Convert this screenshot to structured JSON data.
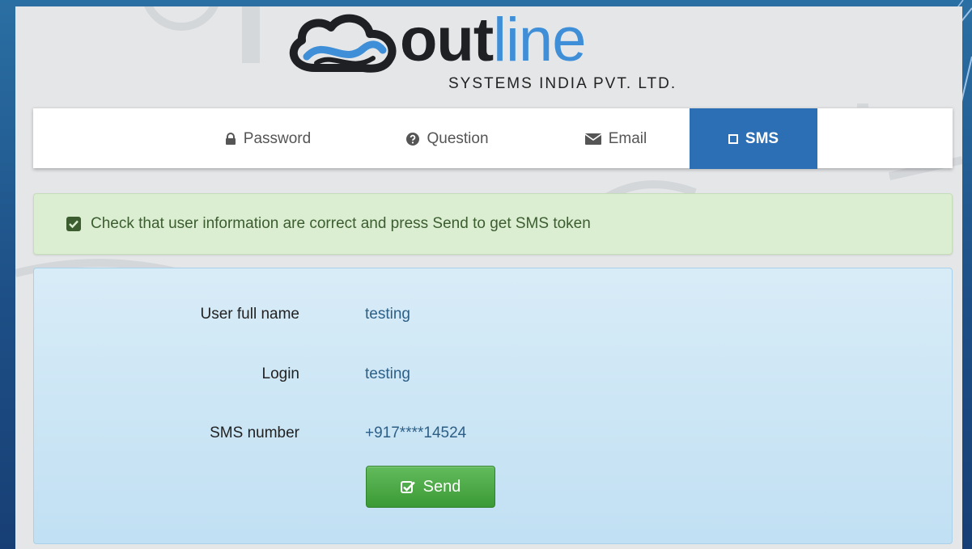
{
  "brand": {
    "name_part1": "out",
    "name_part2": "line",
    "subtitle": "SYSTEMS INDIA PVT. LTD.",
    "colors": {
      "dark": "#1f2024",
      "blue": "#3e8fd8"
    }
  },
  "tabs": [
    {
      "label": "Password",
      "icon": "lock-icon",
      "active": false
    },
    {
      "label": "Question",
      "icon": "question-circle-icon",
      "active": false
    },
    {
      "label": "Email",
      "icon": "envelope-icon",
      "active": false
    },
    {
      "label": "SMS",
      "icon": "mobile-icon",
      "active": true
    }
  ],
  "alert": {
    "icon": "check-square-icon",
    "message": "Check that user information are correct and press Send to get SMS token"
  },
  "user_info": {
    "rows": [
      {
        "label": "User full name",
        "value": "testing"
      },
      {
        "label": "Login",
        "value": "testing"
      },
      {
        "label": "SMS number",
        "value": "+917****14524"
      }
    ],
    "send_label": "Send",
    "send_icon": "edit-check-icon"
  },
  "colors": {
    "active_tab": "#2c6fb5",
    "alert_bg": "#dceed2",
    "card_bg": "#c8e4f4",
    "send_button": "#4cae46"
  }
}
